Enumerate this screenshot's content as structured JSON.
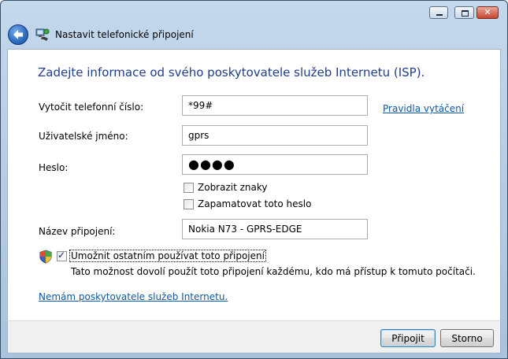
{
  "window": {
    "title": "Nastavit telefonické připojení",
    "close_glyph": "✕"
  },
  "page": {
    "heading": "Zadejte informace od svého poskytovatele služeb Internetu (ISP)."
  },
  "fields": {
    "phone": {
      "label": "Vytočit telefonní číslo:",
      "value": "*99#"
    },
    "username": {
      "label": "Uživatelské jméno:",
      "value": "gprs"
    },
    "password": {
      "label": "Heslo:",
      "value": "●●●●"
    },
    "connection_name": {
      "label": "Název připojení:",
      "value": "Nokia N73 - GPRS-EDGE"
    }
  },
  "links": {
    "dialing_rules": "Pravidla vytáčení",
    "no_isp": "Nemám poskytovatele služeb Internetu."
  },
  "checkboxes": {
    "show_chars": {
      "label": "Zobrazit znaky",
      "checked": false
    },
    "remember_password": {
      "label": "Zapamatovat toto heslo",
      "checked": false
    },
    "allow_others": {
      "label": "Umožnit ostatním používat toto připojení",
      "checked": true
    }
  },
  "allow_others_desc": "Tato možnost dovolí použít toto připojení každému, kdo má přístup k tomuto počítači.",
  "buttons": {
    "connect": "Připojit",
    "cancel": "Storno"
  },
  "icons": {
    "back": "back-arrow-icon",
    "wizard": "network-phone-icon",
    "uac": "uac-shield-icon"
  }
}
